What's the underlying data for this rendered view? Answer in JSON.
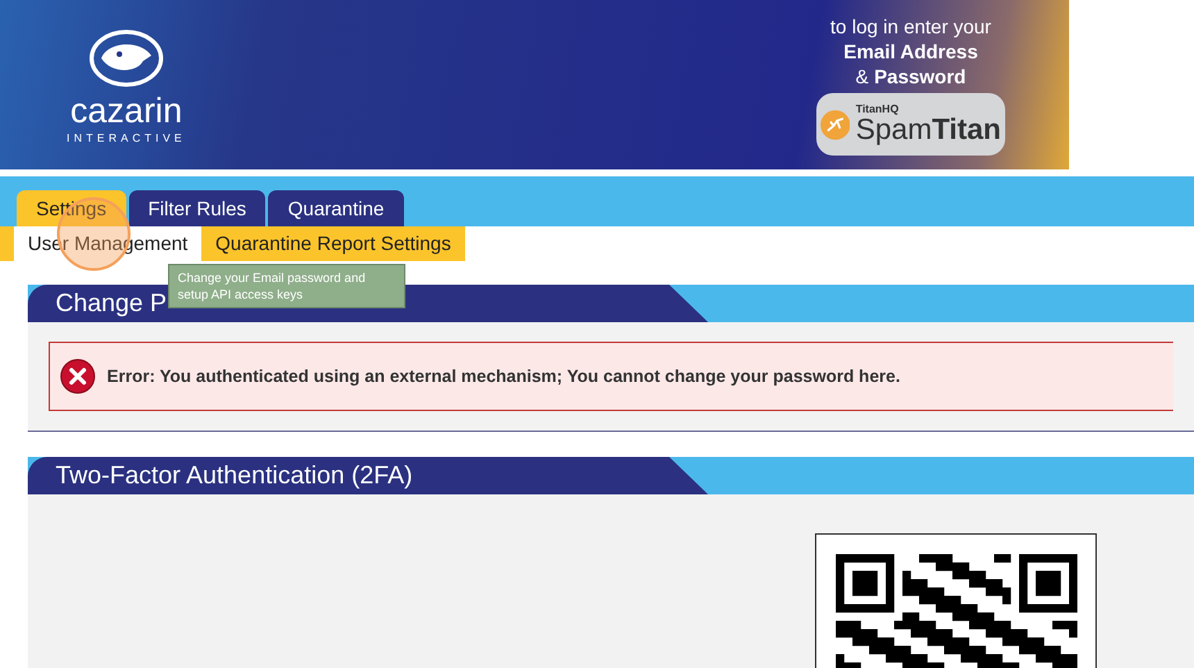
{
  "banner": {
    "brand": "cazarin",
    "brand_sub": "INTERACTIVE",
    "login_hint": "to log in enter your",
    "login_field_1": "Email Address",
    "login_joiner": "&",
    "login_field_2": "Password",
    "badge_vendor": "TitanHQ",
    "badge_product_1": "Spam",
    "badge_product_2": "Titan"
  },
  "tabs": [
    {
      "label": "Settings",
      "selected": true
    },
    {
      "label": "Filter Rules",
      "selected": false
    },
    {
      "label": "Quarantine",
      "selected": false
    }
  ],
  "subtabs": [
    {
      "label": "User Management",
      "selected": true
    },
    {
      "label": "Quarantine Report Settings",
      "selected": false
    }
  ],
  "tooltip": "Change your Email password and setup API access keys",
  "click_highlight": true,
  "panels": [
    {
      "title": "Change P",
      "error": "Error: You authenticated using an external mechanism; You cannot change your password here."
    },
    {
      "title": "Two-Factor Authentication (2FA)",
      "kind": "qr"
    }
  ]
}
